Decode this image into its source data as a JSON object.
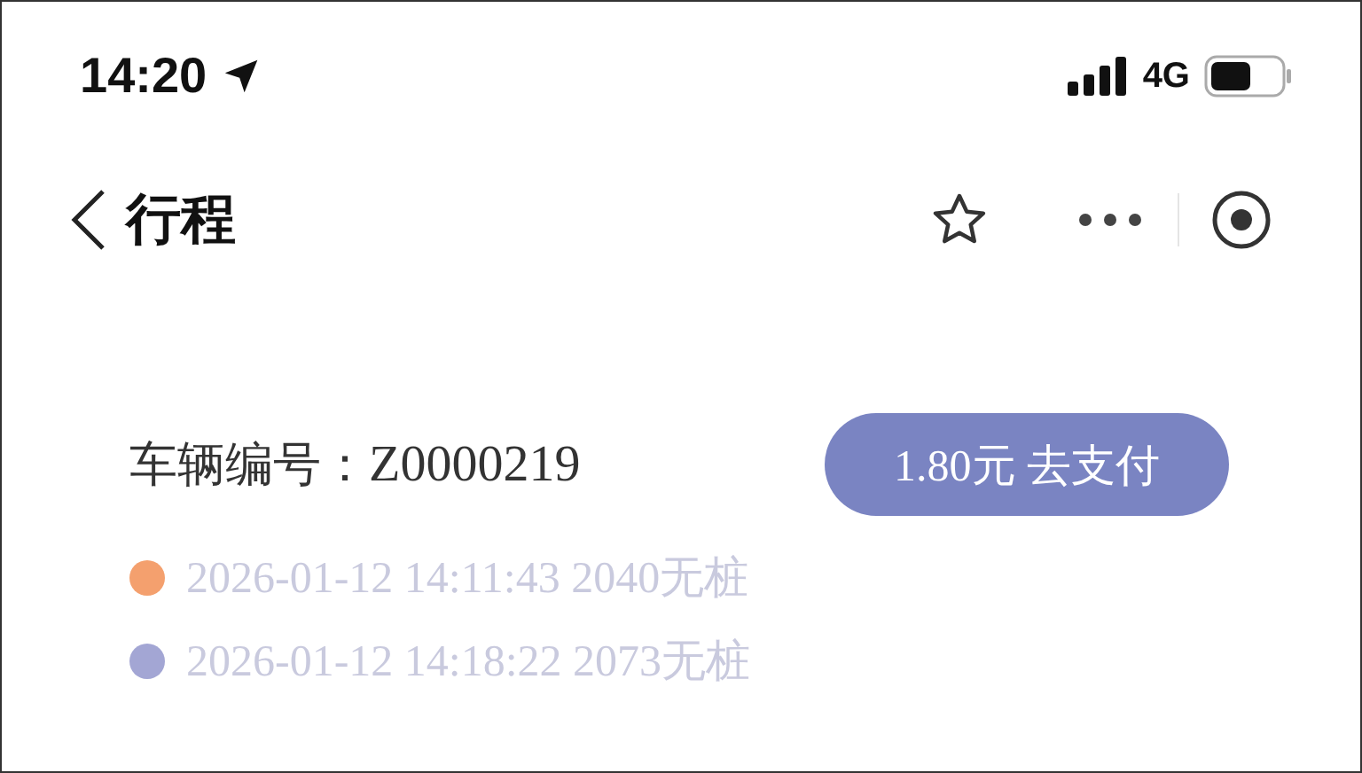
{
  "status_bar": {
    "time": "14:20",
    "network": "4G"
  },
  "nav": {
    "title": "行程"
  },
  "vehicle": {
    "label": "车辆编号：",
    "number": "Z0000219"
  },
  "pay_button": {
    "label": "1.80元 去支付"
  },
  "trip_points": [
    {
      "text": "2026-01-12 14:11:43 2040无桩",
      "color": "#f4a06e"
    },
    {
      "text": "2026-01-12 14:18:22 2073无桩",
      "color": "#a3a6d4"
    }
  ]
}
